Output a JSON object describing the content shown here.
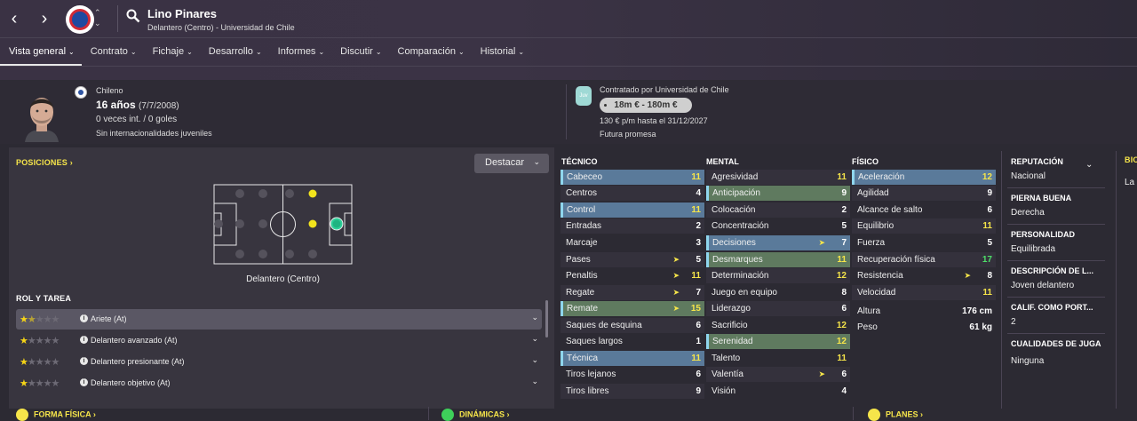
{
  "header": {
    "player_name": "Lino Pinares",
    "subtitle": "Delantero (Centro) - Universidad de Chile",
    "back_icon": "chevron-left-icon",
    "forward_icon": "chevron-right-icon"
  },
  "tabs": [
    {
      "label": "Vista general"
    },
    {
      "label": "Contrato"
    },
    {
      "label": "Fichaje"
    },
    {
      "label": "Desarrollo"
    },
    {
      "label": "Informes"
    },
    {
      "label": "Discutir"
    },
    {
      "label": "Comparación"
    },
    {
      "label": "Historial"
    }
  ],
  "overview": {
    "nationality": "Chileno",
    "age": "16 años",
    "dob": "(7/7/2008)",
    "caps": "0 veces int. / 0 goles",
    "youth_caps": "Sin internacionalidades juveniles",
    "juv_badge": "Juv",
    "contracted_by": "Contratado por Universidad de Chile",
    "value": "18m € - 180m €",
    "wage": "130 € p/m hasta el 31/12/2027",
    "status": "Futura promesa"
  },
  "positions": {
    "title": "POSICIONES",
    "highlight_button": "Destacar",
    "position_label": "Delantero (Centro)"
  },
  "roles": {
    "title": "ROL Y TAREA",
    "items": [
      {
        "name": "Ariete (At)",
        "stars": 1.5
      },
      {
        "name": "Delantero avanzado (At)",
        "stars": 1
      },
      {
        "name": "Delantero presionante (At)",
        "stars": 1
      },
      {
        "name": "Delantero objetivo (At)",
        "stars": 1
      }
    ]
  },
  "tecnico": {
    "title": "TÉCNICO",
    "attrs": [
      {
        "name": "Cabeceo",
        "value": "11"
      },
      {
        "name": "Centros",
        "value": "4"
      },
      {
        "name": "Control",
        "value": "11"
      },
      {
        "name": "Entradas",
        "value": "2"
      },
      {
        "name": "Marcaje",
        "value": "3"
      },
      {
        "name": "Pases",
        "value": "5"
      },
      {
        "name": "Penaltis",
        "value": "11"
      },
      {
        "name": "Regate",
        "value": "7"
      },
      {
        "name": "Remate",
        "value": "15"
      },
      {
        "name": "Saques de esquina",
        "value": "6"
      },
      {
        "name": "Saques largos",
        "value": "1"
      },
      {
        "name": "Técnica",
        "value": "11"
      },
      {
        "name": "Tiros lejanos",
        "value": "6"
      },
      {
        "name": "Tiros libres",
        "value": "9"
      }
    ]
  },
  "mental": {
    "title": "MENTAL",
    "attrs": [
      {
        "name": "Agresividad",
        "value": "11"
      },
      {
        "name": "Anticipación",
        "value": "9"
      },
      {
        "name": "Colocación",
        "value": "2"
      },
      {
        "name": "Concentración",
        "value": "5"
      },
      {
        "name": "Decisiones",
        "value": "7"
      },
      {
        "name": "Desmarques",
        "value": "11"
      },
      {
        "name": "Determinación",
        "value": "12"
      },
      {
        "name": "Juego en equipo",
        "value": "8"
      },
      {
        "name": "Liderazgo",
        "value": "6"
      },
      {
        "name": "Sacrificio",
        "value": "12"
      },
      {
        "name": "Serenidad",
        "value": "12"
      },
      {
        "name": "Talento",
        "value": "11"
      },
      {
        "name": "Valentía",
        "value": "6"
      },
      {
        "name": "Visión",
        "value": "4"
      }
    ]
  },
  "fisico": {
    "title": "FÍSICO",
    "attrs": [
      {
        "name": "Aceleración",
        "value": "12"
      },
      {
        "name": "Agilidad",
        "value": "9"
      },
      {
        "name": "Alcance de salto",
        "value": "6"
      },
      {
        "name": "Equilibrio",
        "value": "11"
      },
      {
        "name": "Fuerza",
        "value": "5"
      },
      {
        "name": "Recuperación física",
        "value": "17"
      },
      {
        "name": "Resistencia",
        "value": "8"
      },
      {
        "name": "Velocidad",
        "value": "11"
      }
    ],
    "height_label": "Altura",
    "height": "176 cm",
    "weight_label": "Peso",
    "weight": "61 kg"
  },
  "profile": {
    "reputation_label": "REPUTACIÓN",
    "reputation": "Nacional",
    "foot_label": "PIERNA BUENA",
    "foot": "Derecha",
    "personality_label": "PERSONALIDAD",
    "personality": "Equilibrada",
    "description_label": "DESCRIPCIÓN DE L...",
    "description": "Joven delantero",
    "rating_label": "CALIF. COMO PORT...",
    "rating": "2",
    "qualities_label": "CUALIDADES DE JUGA",
    "qualities": "Ninguna",
    "bio_label": "BIO",
    "bio_text": "La"
  },
  "footer": {
    "form": "FORMA FÍSICA",
    "dynamics": "DINÁMICAS",
    "plans": "PLANES"
  },
  "colors": {
    "accent_yellow": "#f6e54a",
    "highlight_blue": "#5a7a9a",
    "highlight_green": "#5f7a5f"
  }
}
